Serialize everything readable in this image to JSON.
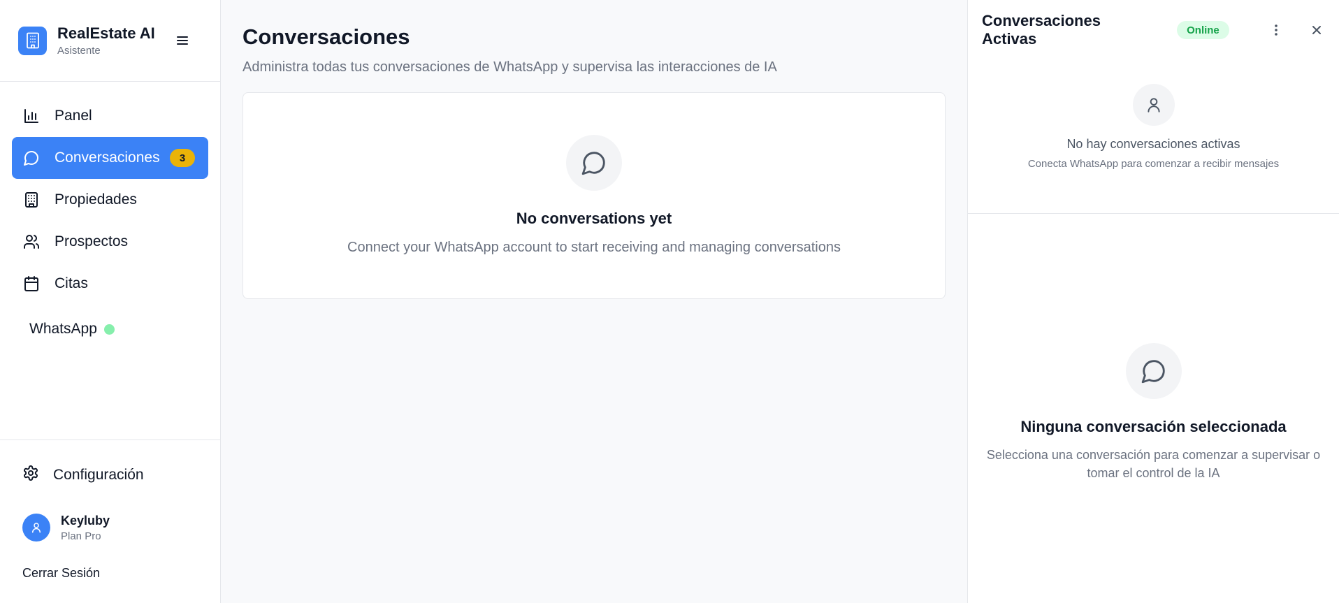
{
  "brand": {
    "title": "RealEstate AI",
    "subtitle": "Asistente"
  },
  "nav": {
    "items": [
      {
        "label": "Panel",
        "icon": "bar-chart-icon"
      },
      {
        "label": "Conversaciones",
        "icon": "message-circle-icon",
        "badge": "3",
        "active": true
      },
      {
        "label": "Propiedades",
        "icon": "building-icon"
      },
      {
        "label": "Prospectos",
        "icon": "users-icon"
      },
      {
        "label": "Citas",
        "icon": "calendar-icon"
      }
    ],
    "whatsapp": {
      "label": "WhatsApp",
      "status_color": "#86efac"
    }
  },
  "settings": {
    "label": "Configuración",
    "icon": "gear-icon"
  },
  "user": {
    "name": "Keyluby",
    "plan": "Plan Pro"
  },
  "logout": {
    "label": "Cerrar Sesión"
  },
  "main": {
    "title": "Conversaciones",
    "subtitle": "Administra todas tus conversaciones de WhatsApp y supervisa las interacciones de IA",
    "empty": {
      "title": "No conversations yet",
      "subtitle": "Connect your WhatsApp account to start receiving and managing conversations"
    }
  },
  "panel": {
    "title": "Conversaciones Activas",
    "status": "Online",
    "no_active": {
      "title": "No hay conversaciones activas",
      "subtitle": "Conecta WhatsApp para comenzar a recibir mensajes"
    },
    "none_selected": {
      "title": "Ninguna conversación seleccionada",
      "subtitle": "Selecciona una conversación para comenzar a supervisar o tomar el control de la IA"
    }
  },
  "colors": {
    "accent": "#3b82f6",
    "badge": "#eab308",
    "online_bg": "#dcfce7",
    "online_text": "#16a34a"
  }
}
